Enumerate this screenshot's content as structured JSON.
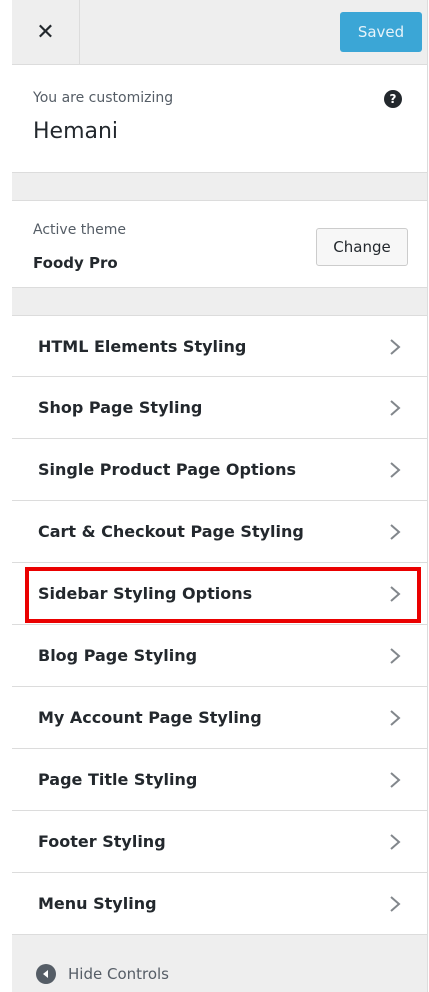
{
  "header": {
    "close_icon": "close-icon",
    "save_label": "Saved",
    "accent_color": "#3ba6d6"
  },
  "info": {
    "customizing_label": "You are customizing",
    "site_name": "Hemani",
    "help_icon": "help-icon",
    "help_glyph": "?"
  },
  "theme": {
    "active_label": "Active theme",
    "name": "Foody Pro",
    "change_label": "Change"
  },
  "menu": {
    "items": [
      {
        "label": "HTML Elements Styling"
      },
      {
        "label": "Shop Page Styling"
      },
      {
        "label": "Single Product Page Options"
      },
      {
        "label": "Cart & Checkout Page Styling"
      },
      {
        "label": "Sidebar Styling Options",
        "highlighted": true
      },
      {
        "label": "Blog Page Styling"
      },
      {
        "label": "My Account Page Styling"
      },
      {
        "label": "Page Title Styling"
      },
      {
        "label": "Footer Styling"
      },
      {
        "label": "Menu Styling"
      }
    ],
    "highlight_color": "#ea0000"
  },
  "footer": {
    "hide_label": "Hide Controls",
    "hide_icon": "collapse-left-icon"
  }
}
